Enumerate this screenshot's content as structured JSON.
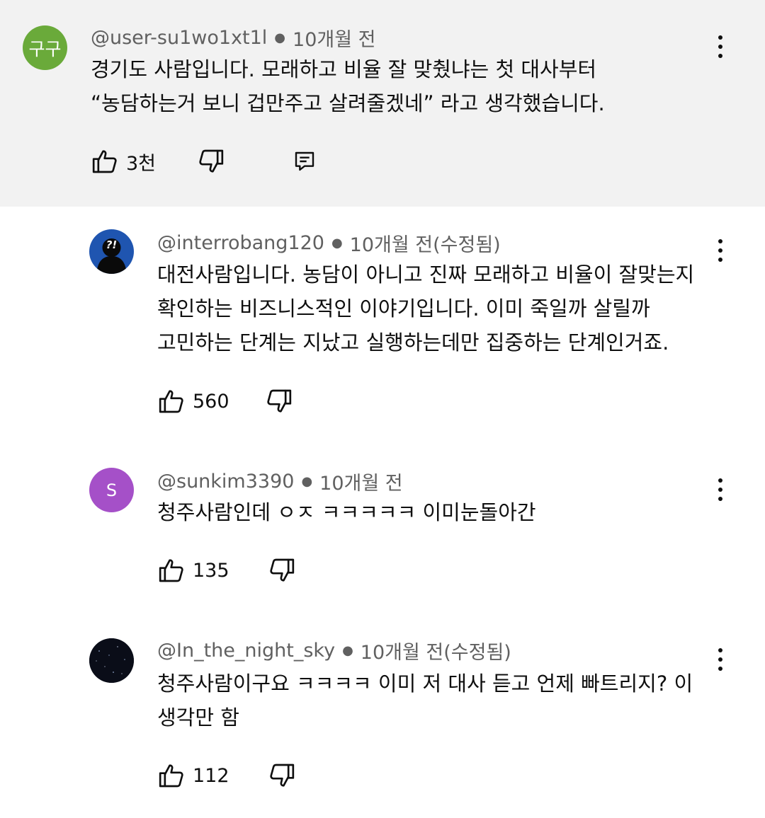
{
  "comments": [
    {
      "avatar_text": "구구",
      "avatar_color": "#6aaa3a",
      "handle": "@user-su1wo1xt1l",
      "time": "10개월 전",
      "lines": [
        "경기도 사람입니다. 모래하고 비율 잘 맞췄냐는 첫 대사부터",
        "“농담하는거 보니 겁만주고 살려줄겠네” 라고 생각했습니다."
      ],
      "likes": "3천"
    },
    {
      "avatar_text": "?!",
      "avatar_color": "#1f55b0",
      "handle": "@interrobang120",
      "time": "10개월 전(수정됨)",
      "lines": [
        "대전사람입니다. 농담이 아니고 진짜 모래하고 비율이 잘맞는지",
        "확인하는 비즈니스적인 이야기입니다. 이미 죽일까 살릴까",
        "고민하는 단계는 지났고 실행하는데만 집중하는 단계인거죠."
      ],
      "likes": "560"
    },
    {
      "avatar_text": "S",
      "avatar_color": "#a550c8",
      "handle": "@sunkim3390",
      "time": "10개월 전",
      "lines": [
        "청주사람인데 ㅇㅈ ㅋㅋㅋㅋㅋ 이미눈돌아간"
      ],
      "likes": "135"
    },
    {
      "avatar_text": "",
      "avatar_color": "#0a0d18",
      "handle": "@In_the_night_sky",
      "time": "10개월 전(수정됨)",
      "lines": [
        "청주사람이구요 ㅋㅋㅋㅋ 이미 저 대사 듣고 언제 빠트리지? 이",
        "생각만 함"
      ],
      "likes": "112"
    }
  ]
}
